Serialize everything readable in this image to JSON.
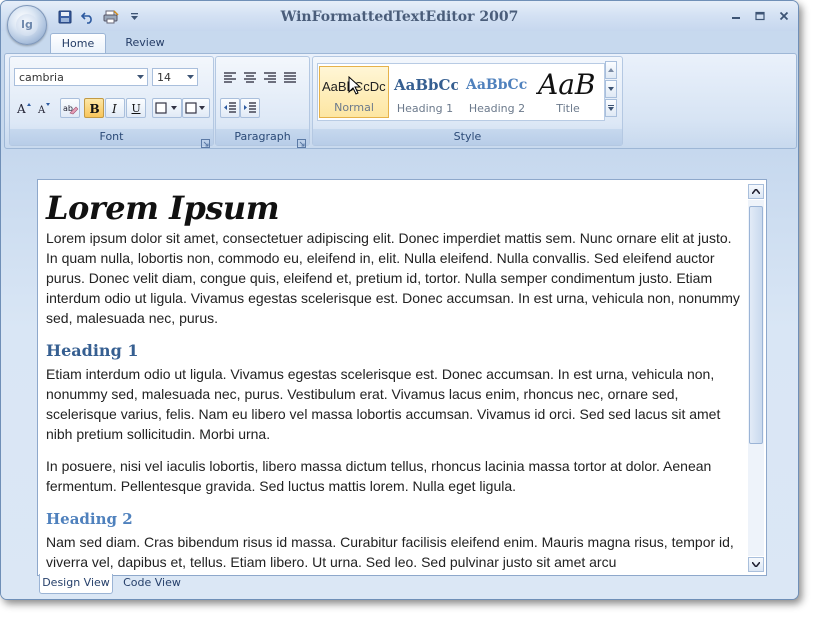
{
  "window": {
    "title": "WinFormattedTextEditor 2007",
    "orb_text": "lg"
  },
  "ribbon": {
    "tabs": [
      {
        "label": "Home"
      },
      {
        "label": "Review"
      }
    ],
    "font_group": {
      "label": "Font",
      "font_name": "cambria",
      "font_size": "14"
    },
    "paragraph_group": {
      "label": "Paragraph"
    },
    "style_group": {
      "label": "Style",
      "styles": [
        {
          "sample": "AaBbCcDc",
          "name": "Normal"
        },
        {
          "sample": "AaBbCc",
          "name": "Heading 1"
        },
        {
          "sample": "AaBbCc",
          "name": "Heading 2"
        },
        {
          "sample": "AaB",
          "name": "Title"
        }
      ]
    }
  },
  "document": {
    "title": "Lorem Ipsum",
    "para1": "Lorem ipsum dolor sit amet, consectetuer adipiscing elit. Donec imperdiet mattis sem. Nunc ornare elit at justo. In quam nulla, lobortis non, commodo eu, eleifend in, elit. Nulla eleifend. Nulla convallis. Sed eleifend auctor purus. Donec velit diam, congue quis, eleifend et, pretium id, tortor. Nulla semper condimentum justo. Etiam interdum odio ut ligula. Vivamus egestas scelerisque est. Donec accumsan. In est urna, vehicula non, nonummy sed, malesuada nec, purus.",
    "heading1": "Heading 1",
    "para2": "Etiam interdum odio ut ligula. Vivamus egestas scelerisque est. Donec accumsan. In est urna, vehicula non, nonummy sed, malesuada nec, purus. Vestibulum erat. Vivamus lacus enim, rhoncus nec, ornare sed, scelerisque varius, felis. Nam eu libero vel massa lobortis accumsan. Vivamus id orci. Sed sed lacus sit amet nibh pretium sollicitudin. Morbi urna.",
    "para3": "In posuere, nisi vel iaculis lobortis, libero massa dictum tellus, rhoncus lacinia massa tortor at dolor. Aenean fermentum. Pellentesque gravida. Sed luctus mattis lorem. Nulla eget ligula.",
    "heading2": "Heading 2",
    "para4": "Nam sed diam. Cras bibendum risus id massa. Curabitur facilisis eleifend enim. Mauris magna risus, tempor id, viverra vel, dapibus et, tellus. Etiam libero. Ut urna. Sed leo. Sed pulvinar justo sit amet arcu"
  },
  "view_tabs": [
    {
      "label": "Design View"
    },
    {
      "label": "Code View"
    }
  ],
  "icons": [
    "save-icon",
    "undo-icon",
    "quick-print-icon",
    "customize-qat-icon",
    "minimize-icon",
    "maximize-icon",
    "close-icon",
    "grow-font-icon",
    "shrink-font-icon",
    "clear-format-icon",
    "bold-icon",
    "italic-icon",
    "underline-icon",
    "border-icon",
    "fill-color-icon",
    "align-left-icon",
    "align-center-icon",
    "align-right-icon",
    "justify-icon",
    "decrease-indent-icon",
    "increase-indent-icon",
    "dialog-launcher-icon",
    "mouse-cursor-icon"
  ],
  "colors": {
    "heading1": "#365f91",
    "heading2": "#4f81bd",
    "ribbon_bg": "#d7e4f4",
    "selected_style": "#fde6a2"
  }
}
